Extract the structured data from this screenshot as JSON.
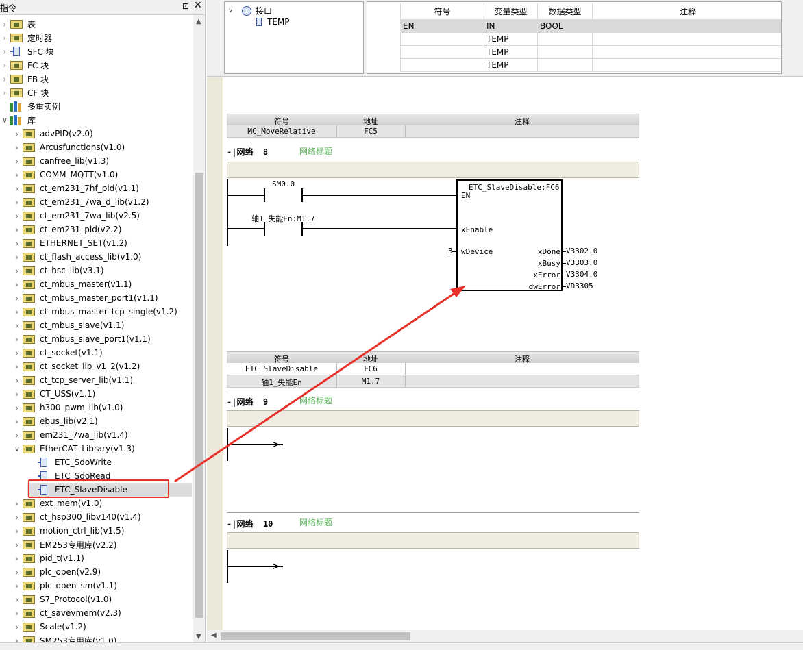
{
  "left_panel": {
    "title": "指令",
    "pin": "⊡",
    "close": "✕",
    "top_items": [
      {
        "label": "表",
        "icon": "table-icon"
      },
      {
        "label": "定时器",
        "icon": "timer-icon"
      },
      {
        "label": "SFC 块",
        "icon": "block-icon"
      },
      {
        "label": "FC 块",
        "icon": "folder-icon"
      },
      {
        "label": "FB 块",
        "icon": "folder-icon"
      },
      {
        "label": "CF 块",
        "icon": "folder-icon"
      },
      {
        "label": "多重实例",
        "icon": "library-icon"
      },
      {
        "label": "库",
        "icon": "library-icon"
      }
    ],
    "libraries": [
      "advPID(v2.0)",
      "Arcusfunctions(v1.0)",
      "canfree_lib(v1.3)",
      "COMM_MQTT(v1.0)",
      "ct_em231_7hf_pid(v1.1)",
      "ct_em231_7wa_d_lib(v1.2)",
      "ct_em231_7wa_lib(v2.5)",
      "ct_em231_pid(v2.2)",
      "ETHERNET_SET(v1.2)",
      "ct_flash_access_lib(v1.0)",
      "ct_hsc_lib(v3.1)",
      "ct_mbus_master(v1.1)",
      "ct_mbus_master_port1(v1.1)",
      "ct_mbus_master_tcp_single(v1.2)",
      "ct_mbus_slave(v1.1)",
      "ct_mbus_slave_port1(v1.1)",
      "ct_socket(v1.1)",
      "ct_socket_lib_v1_2(v1.2)",
      "ct_tcp_server_lib(v1.1)",
      "CT_USS(v1.1)",
      "h300_pwm_lib(v1.0)",
      "ebus_lib(v2.1)",
      "em231_7wa_lib(v1.4)",
      "EtherCAT_Library(v1.3)"
    ],
    "ethercat_children": [
      "ETC_SdoWrite",
      "ETC_SdoRead",
      "ETC_SlaveDisable"
    ],
    "libraries_after": [
      "ext_mem(v1.0)",
      "ct_hsp300_libv140(v1.4)",
      "motion_ctrl_lib(v1.5)",
      "EM253专用库(v2.2)",
      "pid_t(v1.1)",
      "plc_open(v2.9)",
      "plc_open_sm(v1.1)",
      "S7_Protocol(v1.0)",
      "ct_savevmem(v2.3)",
      "Scale(v1.2)",
      "SM253专用库(v1.0)"
    ]
  },
  "interface": {
    "tree_root": "接口",
    "tree_child": "TEMP",
    "columns": [
      "",
      "符号",
      "变量类型",
      "数据类型",
      "注释"
    ],
    "rows": [
      [
        "",
        "EN",
        "IN",
        "BOOL",
        ""
      ],
      [
        "",
        "",
        "TEMP",
        "",
        ""
      ],
      [
        "",
        "",
        "TEMP",
        "",
        ""
      ],
      [
        "",
        "",
        "TEMP",
        "",
        ""
      ]
    ]
  },
  "editor": {
    "symtab1": {
      "headers": [
        "符号",
        "地址",
        "注释"
      ],
      "rows": [
        [
          "MC_MoveRelative",
          "FC5",
          ""
        ]
      ]
    },
    "network8": {
      "label": "网络",
      "number": "8",
      "subtitle": "网络标题",
      "contact1": "SM0.0",
      "contact2": "轴1_失能En:M1.7",
      "fb_title": "ETC_SlaveDisable:FC6",
      "pin_en": "EN",
      "pin_xenable": "xEnable",
      "pin_wdevice": "wDevice",
      "wdevice_value": "3",
      "outputs": [
        {
          "pin": "xDone",
          "value": "V3302.0"
        },
        {
          "pin": "xBusy",
          "value": "V3303.0"
        },
        {
          "pin": "xError",
          "value": "V3304.0"
        },
        {
          "pin": "dwError",
          "value": "VD3305"
        }
      ]
    },
    "symtab2": {
      "headers": [
        "符号",
        "地址",
        "注释"
      ],
      "rows": [
        [
          "ETC_SlaveDisable",
          "FC6",
          ""
        ],
        [
          "轴1_失能En",
          "M1.7",
          ""
        ]
      ]
    },
    "network9": {
      "label": "网络",
      "number": "9",
      "subtitle": "网络标题"
    },
    "network10": {
      "label": "网络",
      "number": "10",
      "subtitle": "网络标题"
    }
  },
  "colors": {
    "highlight_box": "#e8302a",
    "annotation_arrow": "#e8302a",
    "network_subtitle": "#5cb85c",
    "comment_bg": "#efede2"
  }
}
